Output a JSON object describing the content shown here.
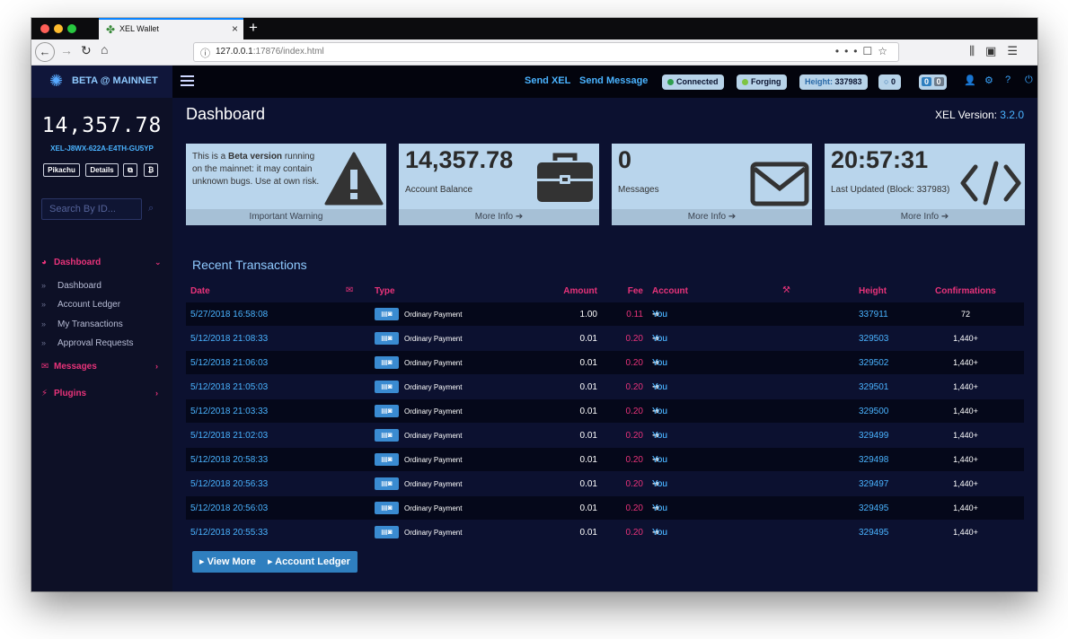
{
  "browser": {
    "tab_title": "XEL Wallet",
    "url_host": "127.0.0.1",
    "url_rest": ":17876/index.html"
  },
  "header": {
    "brand": "BETA @ MAINNET",
    "send_xel": "Send XEL",
    "send_message": "Send Message",
    "status_connected": "Connected",
    "status_forging": "Forging",
    "height_label": "Height:",
    "height_value": "337983",
    "counter_1": "0",
    "counter_2": "0",
    "counter_3": "0",
    "colors": {
      "connected_dot": "#2e9e4e",
      "forging_dot": "#7dc443",
      "accent_blue": "#4ab3ff",
      "accent_pink": "#e8337a"
    }
  },
  "sidebar": {
    "balance": "14,357.78",
    "address": "XEL-J8WX-622A-E4TH-GU5YP",
    "buttons": [
      "Pikachu",
      "Details",
      "⧉",
      "₿"
    ],
    "search_placeholder": "Search By ID...",
    "menu": {
      "dashboard": "Dashboard",
      "dashboard_items": [
        "Dashboard",
        "Account Ledger",
        "My Transactions",
        "Approval Requests"
      ],
      "messages": "Messages",
      "plugins": "Plugins"
    }
  },
  "main": {
    "title": "Dashboard",
    "version_label": "XEL Version:",
    "version": "3.2.0",
    "cards": {
      "warning_pre": "This is a ",
      "warning_bold": "Beta version",
      "warning_post": " running on the mainnet: it may contain unknown bugs. Use at own risk.",
      "warning_footer": "Important Warning",
      "balance_value": "14,357.78",
      "balance_label": "Account Balance",
      "messages_value": "0",
      "messages_label": "Messages",
      "time_value": "20:57:31",
      "time_label": "Last Updated (Block: 337983)",
      "more_info": "More Info ➔"
    },
    "recent_title": "Recent Transactions",
    "columns": {
      "date": "Date",
      "type": "Type",
      "amount": "Amount",
      "fee": "Fee",
      "account": "Account",
      "height": "Height",
      "confirmations": "Confirmations"
    },
    "transactions": [
      {
        "date": "5/27/2018 16:58:08",
        "type": "Ordinary Payment",
        "amount": "1.00",
        "fee": "0.11",
        "from": "You",
        "to": "You",
        "height": "337911",
        "conf": "72"
      },
      {
        "date": "5/12/2018 21:08:33",
        "type": "Ordinary Payment",
        "amount": "0.01",
        "fee": "0.20",
        "from": "You",
        "to": "You",
        "height": "329503",
        "conf": "1,440+"
      },
      {
        "date": "5/12/2018 21:06:03",
        "type": "Ordinary Payment",
        "amount": "0.01",
        "fee": "0.20",
        "from": "You",
        "to": "You",
        "height": "329502",
        "conf": "1,440+"
      },
      {
        "date": "5/12/2018 21:05:03",
        "type": "Ordinary Payment",
        "amount": "0.01",
        "fee": "0.20",
        "from": "You",
        "to": "You",
        "height": "329501",
        "conf": "1,440+"
      },
      {
        "date": "5/12/2018 21:03:33",
        "type": "Ordinary Payment",
        "amount": "0.01",
        "fee": "0.20",
        "from": "You",
        "to": "You",
        "height": "329500",
        "conf": "1,440+"
      },
      {
        "date": "5/12/2018 21:02:03",
        "type": "Ordinary Payment",
        "amount": "0.01",
        "fee": "0.20",
        "from": "You",
        "to": "You",
        "height": "329499",
        "conf": "1,440+"
      },
      {
        "date": "5/12/2018 20:58:33",
        "type": "Ordinary Payment",
        "amount": "0.01",
        "fee": "0.20",
        "from": "You",
        "to": "You",
        "height": "329498",
        "conf": "1,440+"
      },
      {
        "date": "5/12/2018 20:56:33",
        "type": "Ordinary Payment",
        "amount": "0.01",
        "fee": "0.20",
        "from": "You",
        "to": "You",
        "height": "329497",
        "conf": "1,440+"
      },
      {
        "date": "5/12/2018 20:56:03",
        "type": "Ordinary Payment",
        "amount": "0.01",
        "fee": "0.20",
        "from": "You",
        "to": "You",
        "height": "329495",
        "conf": "1,440+"
      },
      {
        "date": "5/12/2018 20:55:33",
        "type": "Ordinary Payment",
        "amount": "0.01",
        "fee": "0.20",
        "from": "You",
        "to": "You",
        "height": "329495",
        "conf": "1,440+"
      }
    ],
    "view_more": "View More",
    "account_ledger": "Account Ledger"
  }
}
